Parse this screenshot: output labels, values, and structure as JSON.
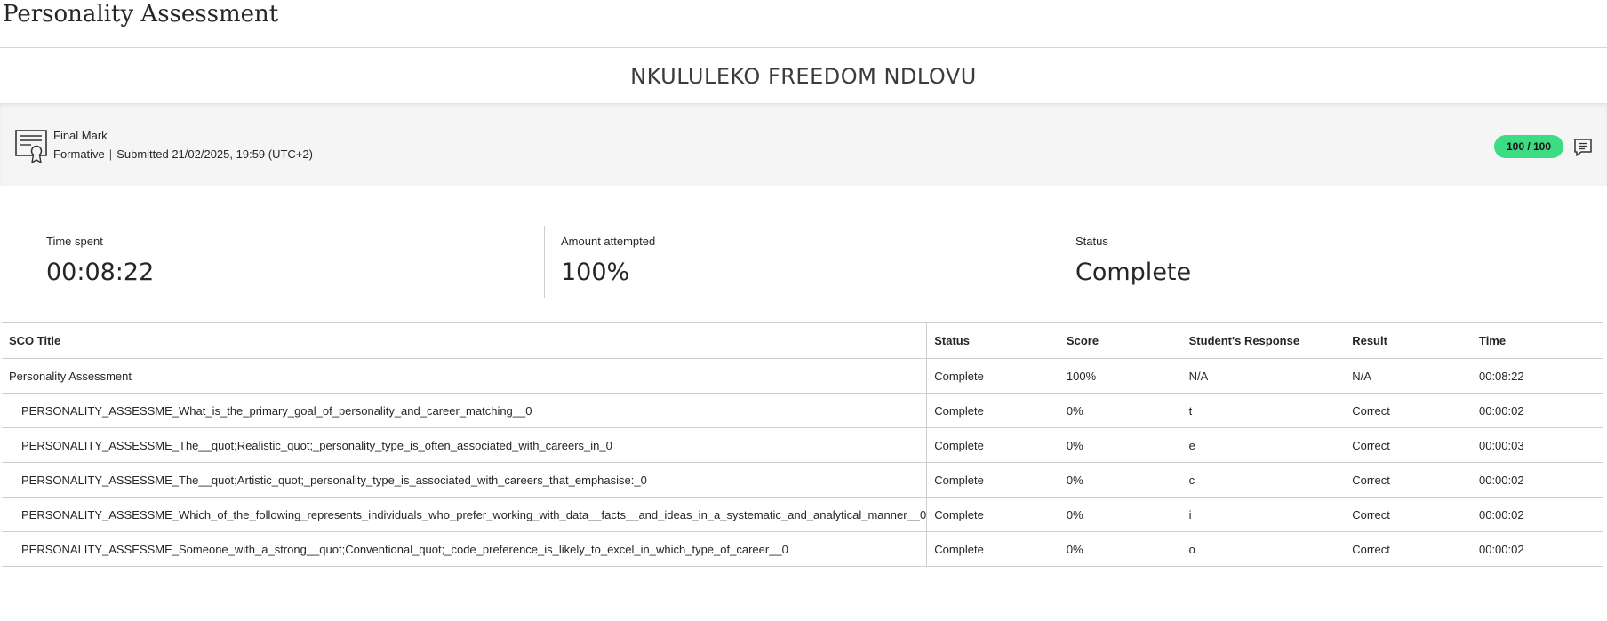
{
  "page": {
    "title": "Personality Assessment"
  },
  "student": {
    "name": "NKULULEKO FREEDOM NDLOVU"
  },
  "grade": {
    "icon": "certificate-icon",
    "title": "Final Mark",
    "type": "Formative",
    "submitted": "Submitted 21/02/2025, 19:59 (UTC+2)",
    "score": "100 / 100",
    "score_color": "#3ddc84",
    "feedback_icon": "comment-icon"
  },
  "stats": {
    "time_spent": {
      "label": "Time spent",
      "value": "00:08:22"
    },
    "amount_attempted": {
      "label": "Amount attempted",
      "value": "100%"
    },
    "status": {
      "label": "Status",
      "value": "Complete"
    }
  },
  "table": {
    "headers": [
      "SCO Title",
      "Status",
      "Score",
      "Student's Response",
      "Result",
      "Time"
    ],
    "rows": [
      [
        "Personality Assessment",
        "Complete",
        "100%",
        "N/A",
        "N/A",
        "00:08:22"
      ],
      [
        "PERSONALITY_ASSESSME_What_is_the_primary_goal_of_personality_and_career_matching__0",
        "Complete",
        "0%",
        "t",
        "Correct",
        "00:00:02"
      ],
      [
        "PERSONALITY_ASSESSME_The__quot;Realistic_quot;_personality_type_is_often_associated_with_careers_in_0",
        "Complete",
        "0%",
        "e",
        "Correct",
        "00:00:03"
      ],
      [
        "PERSONALITY_ASSESSME_The__quot;Artistic_quot;_personality_type_is_associated_with_careers_that_emphasise:_0",
        "Complete",
        "0%",
        "c",
        "Correct",
        "00:00:02"
      ],
      [
        "PERSONALITY_ASSESSME_Which_of_the_following_represents_individuals_who_prefer_working_with_data__facts__and_ideas_in_a_systematic_and_analytical_manner__0",
        "Complete",
        "0%",
        "i",
        "Correct",
        "00:00:02"
      ],
      [
        "PERSONALITY_ASSESSME_Someone_with_a_strong__quot;Conventional_quot;_code_preference_is_likely_to_excel_in_which_type_of_career__0",
        "Complete",
        "0%",
        "o",
        "Correct",
        "00:00:02"
      ]
    ]
  }
}
